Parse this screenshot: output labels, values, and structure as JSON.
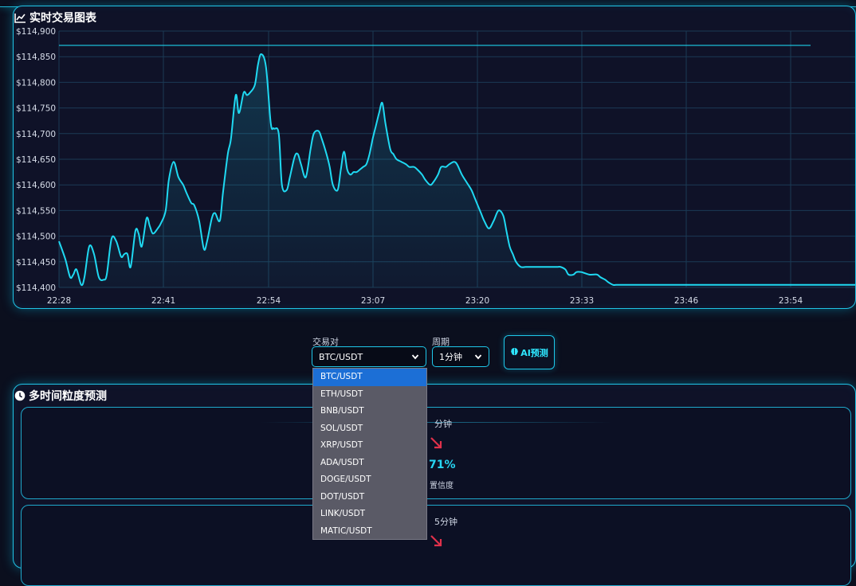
{
  "chart_panel": {
    "title": "实时交易图表",
    "icon": "line-chart-icon"
  },
  "chart_data": {
    "type": "area",
    "title": "实时交易图表",
    "xlabel": "",
    "ylabel": "",
    "yticks": [
      "$114,900",
      "$114,850",
      "$114,800",
      "$114,750",
      "$114,700",
      "$114,650",
      "$114,600",
      "$114,550",
      "$114,500",
      "$114,450",
      "$114,400"
    ],
    "xticks": [
      "22:28",
      "22:41",
      "22:54",
      "23:07",
      "23:20",
      "23:33",
      "23:46",
      "23:54"
    ],
    "ylim": [
      114400,
      114900
    ],
    "xlim": [
      0,
      1000
    ],
    "grid": true,
    "reference_line": 114872,
    "line_color": "#1fd9f2",
    "series": [
      {
        "x": [
          0,
          8,
          14,
          18,
          22,
          28,
          32,
          38,
          44,
          50,
          56,
          60,
          66,
          72,
          78,
          82,
          86,
          90,
          96,
          100,
          104,
          110,
          114,
          118,
          124,
          128,
          134,
          138,
          144,
          150,
          156,
          160,
          166,
          170,
          176,
          182,
          186,
          192,
          196,
          202,
          206,
          212,
          216,
          222,
          226,
          232,
          236,
          240,
          246,
          250,
          254,
          260,
          266,
          270,
          276,
          280,
          286,
          290,
          296,
          300,
          304,
          310,
          316,
          320,
          326,
          330,
          336,
          340,
          344,
          350,
          354,
          358,
          362,
          366,
          370,
          374,
          378,
          382,
          386,
          390,
          394,
          398,
          402,
          406,
          410,
          416,
          420,
          424,
          430,
          436,
          440,
          446,
          450,
          456,
          460,
          466,
          470,
          476,
          480,
          486,
          490,
          496,
          500,
          506,
          512,
          518,
          522,
          526,
          530,
          534,
          540,
          546,
          552,
          558,
          562,
          566,
          570,
          574,
          580,
          586,
          592,
          596,
          600,
          606,
          610,
          616,
          620,
          626,
          630,
          636,
          640,
          646,
          650,
          656,
          660,
          666,
          670,
          676,
          680,
          686,
          690,
          696,
          700,
          706,
          712,
          718,
          722,
          726,
          730,
          736,
          742,
          748,
          752,
          756,
          760,
          766,
          770,
          776,
          780,
          786,
          790,
          796,
          800,
          806,
          812,
          818,
          822,
          826,
          830,
          836,
          842,
          848,
          852,
          858,
          864,
          870,
          876,
          880,
          886,
          890,
          896,
          900,
          906,
          912,
          918,
          922,
          926,
          932,
          938,
          944,
          950,
          956,
          962,
          968,
          974,
          980,
          986,
          992,
          1000
        ],
        "y": [
          114490,
          114455,
          114420,
          114425,
          114435,
          114405,
          114420,
          114480,
          114465,
          114420,
          114415,
          114425,
          114495,
          114490,
          114460,
          114465,
          114465,
          114440,
          114510,
          114505,
          114480,
          114535,
          114520,
          114505,
          114515,
          114525,
          114550,
          114610,
          114645,
          114615,
          114600,
          114585,
          114565,
          114560,
          114530,
          114475,
          114490,
          114535,
          114545,
          114530,
          114585,
          114660,
          114690,
          114775,
          114740,
          114780,
          114775,
          114780,
          114795,
          114835,
          114855,
          114830,
          114720,
          114710,
          114700,
          114600,
          114590,
          114615,
          114655,
          114660,
          114640,
          114615,
          114670,
          114700,
          114705,
          114690,
          114660,
          114635,
          114600,
          114590,
          114630,
          114665,
          114630,
          114620,
          114625,
          114625,
          114630,
          114635,
          114640,
          114660,
          114690,
          114715,
          114740,
          114760,
          114720,
          114670,
          114660,
          114650,
          114645,
          114640,
          114635,
          114635,
          114630,
          114620,
          114610,
          114600,
          114605,
          114620,
          114635,
          114635,
          114640,
          114645,
          114640,
          114620,
          114605,
          114590,
          114575,
          114560,
          114545,
          114530,
          114515,
          114530,
          114550,
          114540,
          114510,
          114480,
          114465,
          114450,
          114440,
          114440,
          114440,
          114440,
          114440,
          114440,
          114440,
          114440,
          114440,
          114440,
          114440,
          114435,
          114425,
          114425,
          114430,
          114430,
          114428,
          114425,
          114425,
          114425,
          114420,
          114415,
          114410,
          114405,
          114405,
          114405,
          114405,
          114405,
          114405,
          114405,
          114405,
          114405,
          114405,
          114405,
          114405,
          114405,
          114405,
          114405,
          114405,
          114405,
          114405,
          114405,
          114405,
          114405,
          114405,
          114405,
          114405,
          114405,
          114405,
          114405,
          114405,
          114405,
          114405,
          114405,
          114405,
          114405,
          114405,
          114405,
          114405,
          114405,
          114405,
          114405,
          114405,
          114405,
          114405,
          114405,
          114405,
          114405,
          114405,
          114405,
          114405,
          114405,
          114405,
          114405,
          114405,
          114405,
          114405,
          114405,
          114405,
          114405,
          114405
        ]
      }
    ]
  },
  "controls": {
    "pair_label": "交易对",
    "pair_value": "BTC/USDT",
    "period_label": "周期",
    "period_value": "1分钟",
    "predict_button": "AI预测",
    "predict_icon": "brain-icon"
  },
  "pair_options": [
    "BTC/USDT",
    "ETH/USDT",
    "BNB/USDT",
    "SOL/USDT",
    "XRP/USDT",
    "ADA/USDT",
    "DOGE/USDT",
    "DOT/USDT",
    "LINK/USDT",
    "MATIC/USDT"
  ],
  "multi_panel": {
    "title": "多时间粒度预测",
    "icon": "clock-icon",
    "cards": [
      {
        "period": "分钟",
        "direction": "down",
        "value": "71%",
        "confidence_label": "置信度"
      },
      {
        "period": "5分钟",
        "direction": "down"
      }
    ]
  },
  "colors": {
    "accent": "#1fc8ea",
    "line": "#1fd9f2",
    "down_arrow": "#e0314b",
    "dropdown_selected": "#1c6fd6"
  }
}
